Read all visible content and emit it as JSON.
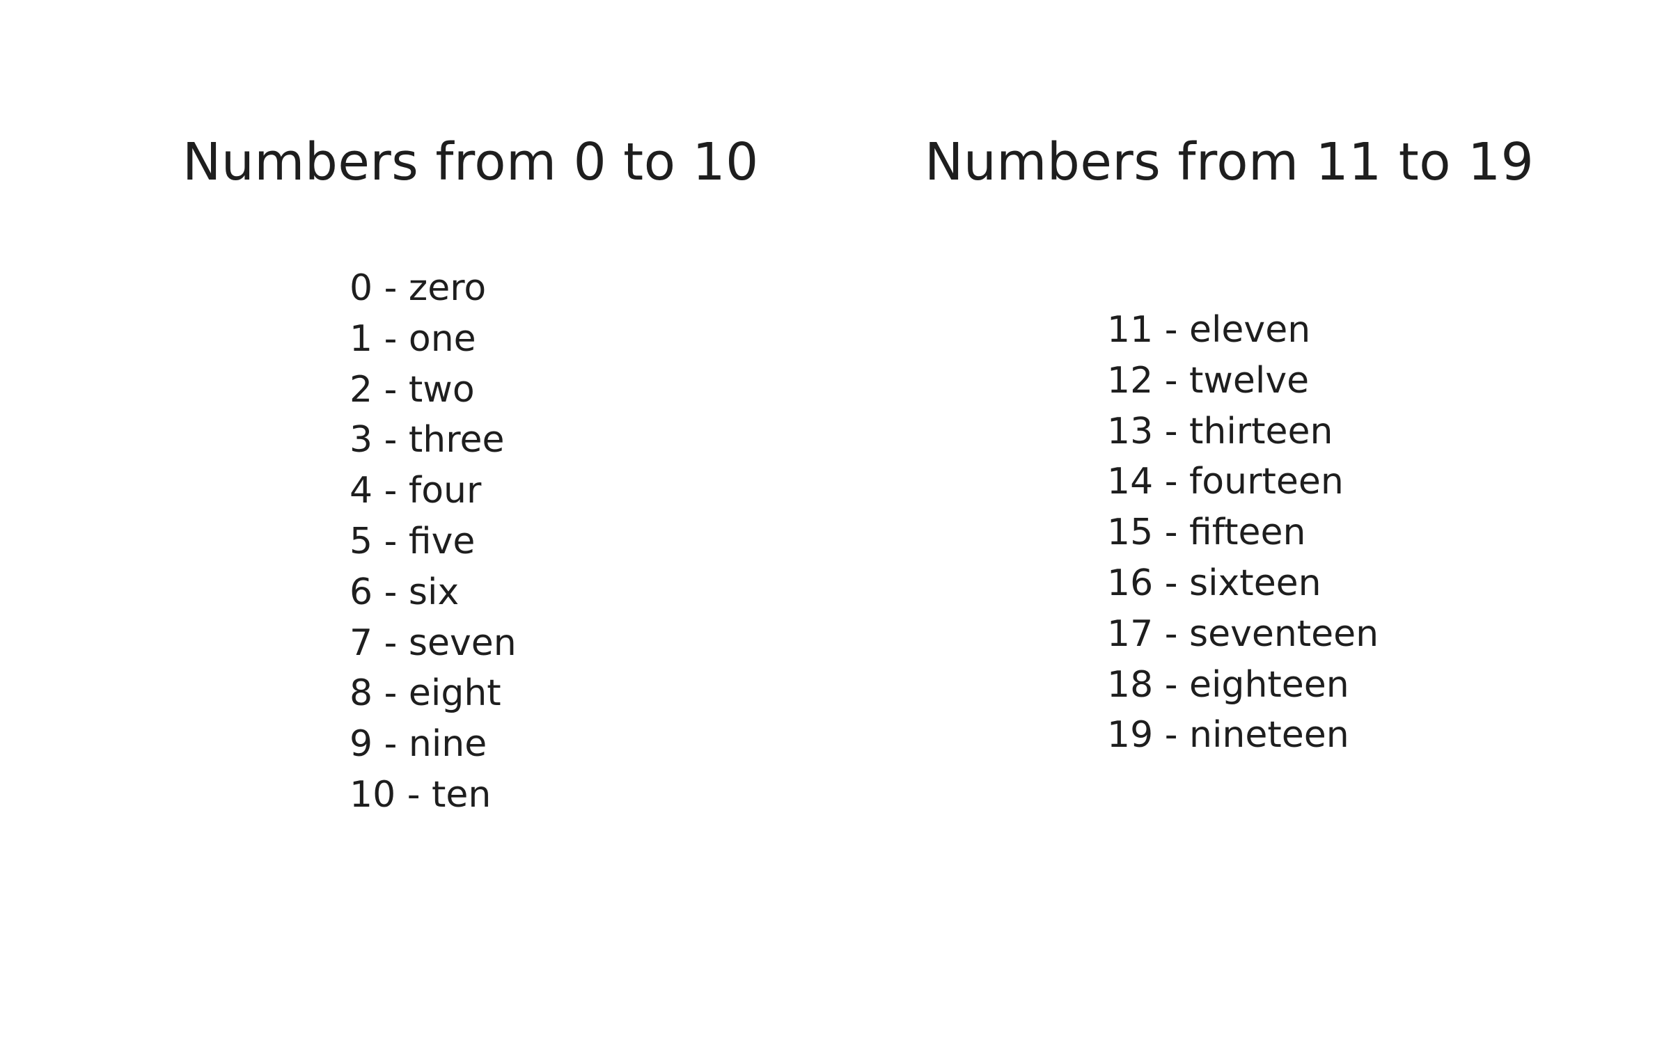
{
  "left_column": {
    "title": "Numbers from 0 to 10",
    "items": [
      "0 - zero",
      "1 - one",
      "2 - two",
      "3 - three",
      "4 - four",
      "5 - five",
      "6 - six",
      "7 - seven",
      "8 - eight",
      "9 - nine",
      "10 - ten"
    ]
  },
  "right_column": {
    "title": "Numbers from 11 to 19",
    "items": [
      "11 - eleven",
      "12 - twelve",
      "13 - thirteen",
      "14 - fourteen",
      "15 - fifteen",
      "16 - sixteen",
      "17 - seventeen",
      "18 - eighteen",
      "19 - nineteen"
    ]
  },
  "colors": {
    "text": "#1e1e1e",
    "background": "#ffffff"
  }
}
